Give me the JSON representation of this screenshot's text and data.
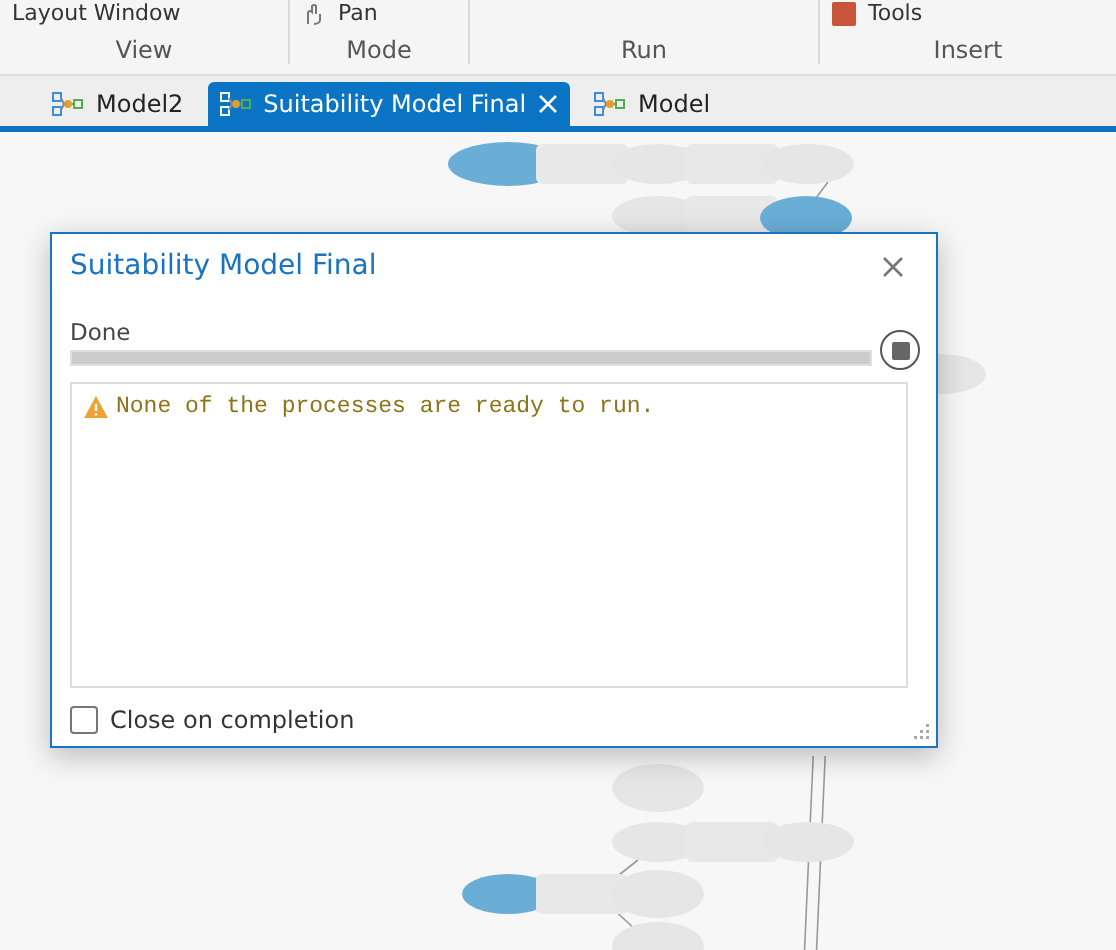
{
  "ribbon": {
    "items": [
      {
        "label": "Layout  Window"
      },
      {
        "label": "Pan"
      },
      {
        "label": "Tools"
      }
    ],
    "groups": [
      {
        "label": "View"
      },
      {
        "label": "Mode"
      },
      {
        "label": "Run"
      },
      {
        "label": "Insert"
      }
    ]
  },
  "tabs": [
    {
      "label": "Model2",
      "selected": false
    },
    {
      "label": "Suitability Model Final",
      "selected": true
    },
    {
      "label": "Model",
      "selected": false
    }
  ],
  "dialog": {
    "title": "Suitability Model Final",
    "status": "Done",
    "progress": {
      "level": 1
    },
    "messages": [
      {
        "kind": "warning",
        "text": "None of the processes are ready to run."
      }
    ],
    "close_on_completion": {
      "label": "Close on completion",
      "checked": false
    }
  }
}
